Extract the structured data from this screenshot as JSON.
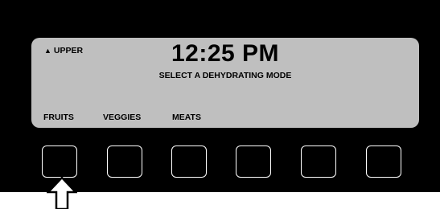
{
  "display": {
    "zone_indicator": "▲",
    "zone_label": "UPPER",
    "time": "12:25 PM",
    "instruction": "SELECT A DEHYDRATING MODE",
    "soft_labels": [
      "FRUITS",
      "VEGGIES",
      "MEATS"
    ]
  },
  "buttons": [
    {
      "name": "soft-button-1"
    },
    {
      "name": "soft-button-2"
    },
    {
      "name": "soft-button-3"
    },
    {
      "name": "soft-button-4"
    },
    {
      "name": "soft-button-5"
    },
    {
      "name": "soft-button-6"
    }
  ],
  "colors": {
    "panel": "#000000",
    "lcd": "#bfbfbf",
    "button_border": "#ffffff"
  },
  "pointer": {
    "icon": "up-arrow-icon",
    "target": "soft-button-1"
  }
}
